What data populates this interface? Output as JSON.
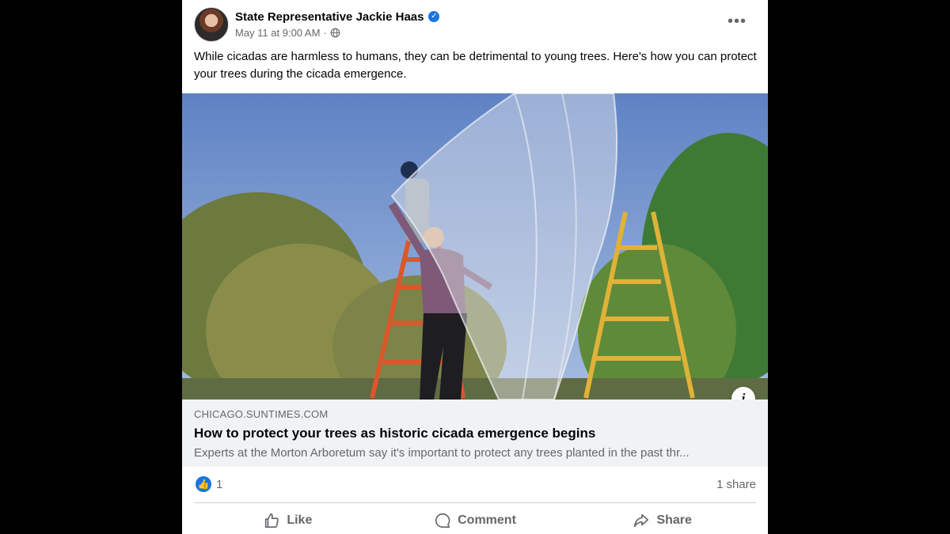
{
  "post": {
    "author": "State Representative Jackie Haas",
    "verified_icon": "verified-badge-icon",
    "date": "May 11 at 9:00 AM",
    "separator": "·",
    "audience_icon": "globe-icon",
    "more_label": "•••",
    "caption": "While cicadas are harmless to humans, they can be detrimental to young trees. Here's how you can protect your trees during the cicada emergence."
  },
  "link_preview": {
    "image_alt": "Two people on ladders draping netting over a young tree",
    "info_label": "i",
    "domain": "CHICAGO.SUNTIMES.COM",
    "title": "How to protect your trees as historic cicada emergence begins",
    "description": "Experts at the Morton Arboretum say it's important to protect any trees planted in the past thr..."
  },
  "stats": {
    "like_count": "1",
    "share_count": "1",
    "share_word": "share"
  },
  "actions": {
    "like": "Like",
    "comment": "Comment",
    "share": "Share"
  },
  "colors": {
    "accent": "#1b74e4",
    "secondary_text": "#65676b",
    "link_bg": "#f0f2f5"
  }
}
